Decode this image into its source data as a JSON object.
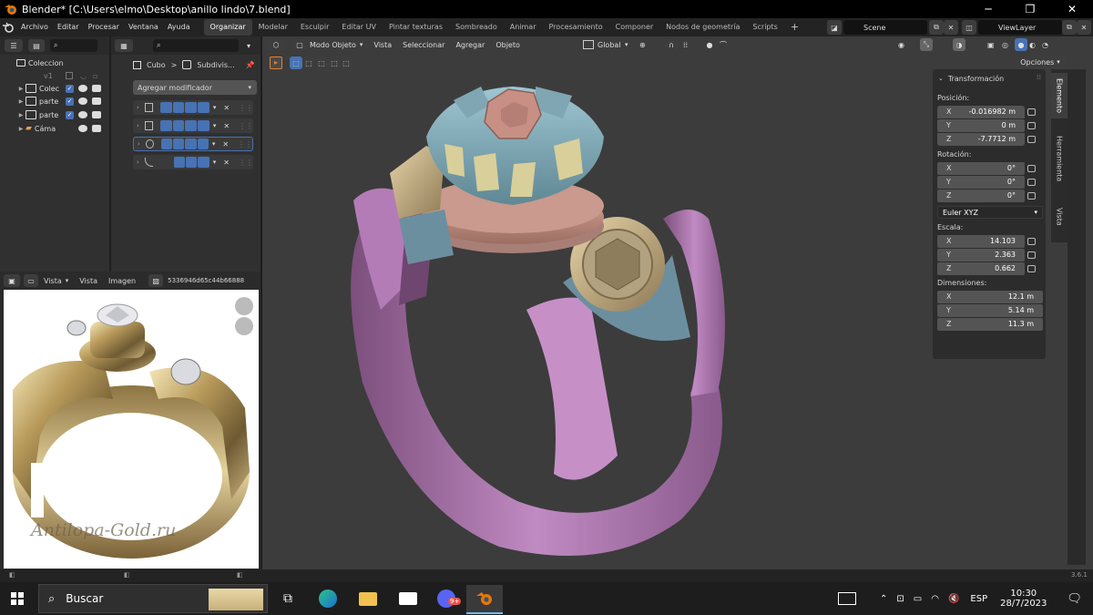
{
  "window": {
    "title": "Blender* [C:\\Users\\elmo\\Desktop\\anillo lindo\\7.blend]",
    "minimize": "─",
    "maximize": "❐",
    "close": "✕"
  },
  "menu": [
    "Archivo",
    "Editar",
    "Procesar",
    "Ventana",
    "Ayuda"
  ],
  "workspaces": [
    "Organizar",
    "Modelar",
    "Esculpir",
    "Editar UV",
    "Pintar texturas",
    "Sombreado",
    "Animar",
    "Procesamiento",
    "Componer",
    "Nodos de geometría",
    "Scripts"
  ],
  "workspace_plus": "+",
  "scene": {
    "label": "Scene",
    "view_layer": "ViewLayer"
  },
  "outliner": {
    "title": "Coleccion",
    "rows": [
      {
        "label": "v1"
      },
      {
        "label": "Colec"
      },
      {
        "label": "parte"
      },
      {
        "label": "parte"
      },
      {
        "label": "Cáma"
      }
    ]
  },
  "properties": {
    "breadcrumb_object": "Cubo",
    "breadcrumb_sep": ">",
    "breadcrumb_modifier": "Subdivis...",
    "add_modifier": "Agregar modificador"
  },
  "image_editor": {
    "view_menu": "Vista",
    "menus": [
      "Vista",
      "Imagen"
    ],
    "image_name": "5336946d65c44b66888",
    "watermark": "Antilopa-Gold.ru"
  },
  "viewport": {
    "mode": "Modo Objeto",
    "menus": [
      "Vista",
      "Seleccionar",
      "Agregar",
      "Objeto"
    ],
    "orientation": "Global",
    "options": "Opciones",
    "transform_panel": {
      "title": "Transformación",
      "position_label": "Posición:",
      "position": [
        {
          "axis": "X",
          "value": "-0.016982 m"
        },
        {
          "axis": "Y",
          "value": "0 m"
        },
        {
          "axis": "Z",
          "value": "-7.7712 m"
        }
      ],
      "rotation_label": "Rotación:",
      "rotation": [
        {
          "axis": "X",
          "value": "0°"
        },
        {
          "axis": "Y",
          "value": "0°"
        },
        {
          "axis": "Z",
          "value": "0°"
        }
      ],
      "rotation_mode": "Euler XYZ",
      "scale_label": "Escala:",
      "scale": [
        {
          "axis": "X",
          "value": "14.103"
        },
        {
          "axis": "Y",
          "value": "2.363"
        },
        {
          "axis": "Z",
          "value": "0.662"
        }
      ],
      "dimensions_label": "Dimensiones:",
      "dimensions": [
        {
          "axis": "X",
          "value": "12.1 m"
        },
        {
          "axis": "Y",
          "value": "5.14 m"
        },
        {
          "axis": "Z",
          "value": "11.3 m"
        }
      ]
    },
    "side_tabs": [
      "Elemento",
      "Herramienta",
      "Vista"
    ]
  },
  "status": {
    "version": "3.6.1"
  },
  "taskbar": {
    "search": "Buscar",
    "badge": "9+",
    "language": "ESP",
    "time": "10:30",
    "date": "28/7/2023"
  }
}
